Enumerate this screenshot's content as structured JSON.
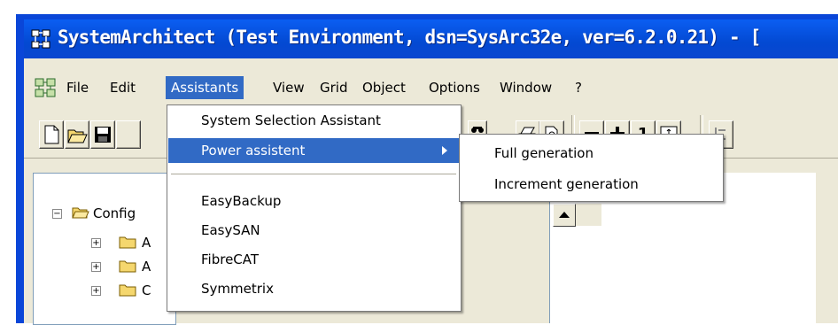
{
  "window": {
    "title": "SystemArchitect (Test Environment, dsn=SysArc32e, ver=6.2.0.21) - [",
    "title_color": "#ffffff",
    "frame_color": "#0a46d8",
    "app_icon": "network-icon"
  },
  "menubar": {
    "items": [
      "File",
      "Edit",
      "Assistants",
      "View",
      "Grid",
      "Object",
      "Options",
      "Window",
      "?"
    ],
    "active": "Assistants",
    "highlight_color": "#316ac5"
  },
  "toolbar": {
    "buttons": [
      "new-file-icon",
      "open-folder-icon",
      "save-icon",
      "find-icon",
      "print-icon",
      "print-preview-icon",
      "zoom-out-icon",
      "zoom-in-icon",
      "zoom-1-icon",
      "fit-icon",
      "align-icon"
    ],
    "zoom_label": "1"
  },
  "tree": {
    "root_label": "Config",
    "children": [
      {
        "label": "A"
      },
      {
        "label": "A"
      },
      {
        "label": "C"
      }
    ]
  },
  "assistants_menu": {
    "items": [
      {
        "label": "System Selection Assistant"
      },
      {
        "label": "Power assistent",
        "has_submenu": true
      },
      {
        "label": "EasyBackup"
      },
      {
        "label": "EasySAN"
      },
      {
        "label": "FibreCAT"
      },
      {
        "label": "Symmetrix"
      }
    ]
  },
  "power_submenu": {
    "items": [
      "Full generation",
      "Increment generation"
    ]
  }
}
